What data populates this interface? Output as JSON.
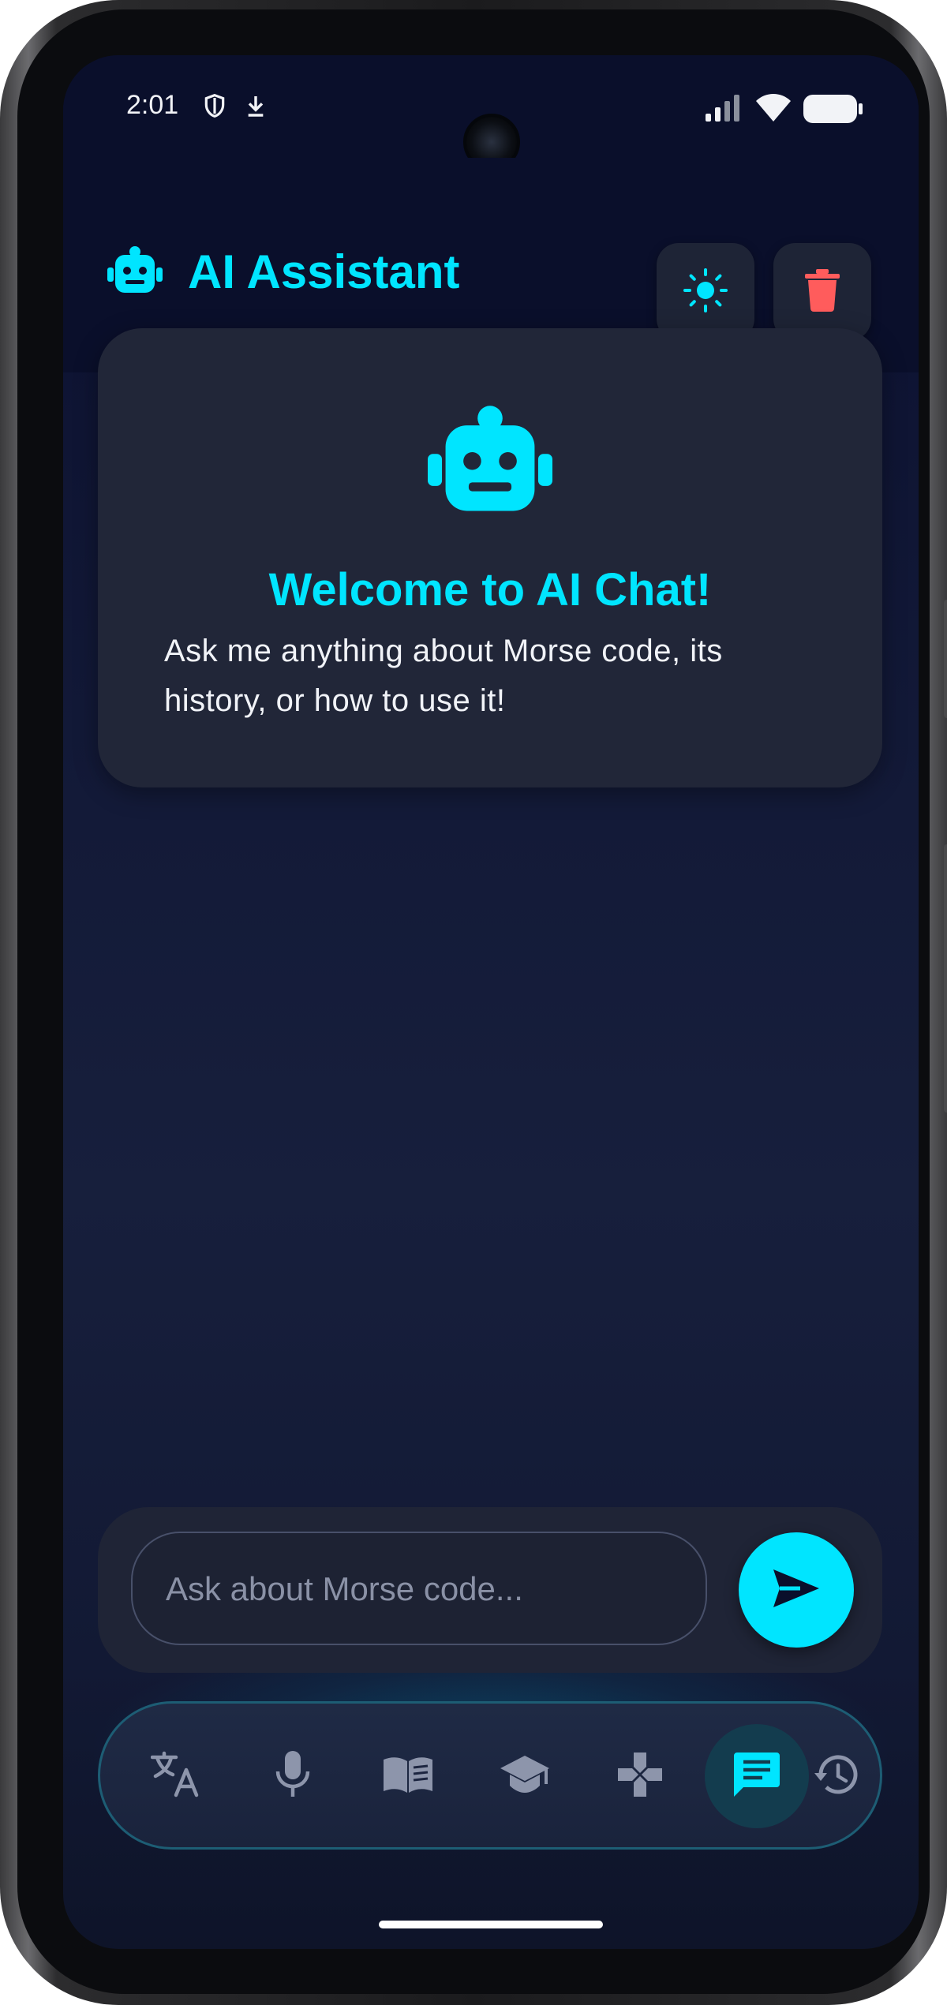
{
  "status_bar": {
    "time": "2:01",
    "icons": [
      "shield-icon",
      "download-icon",
      "signal-icon",
      "wifi-icon",
      "battery-icon"
    ]
  },
  "header": {
    "title": "AI Assistant",
    "logo_icon": "robot-icon",
    "actions": [
      {
        "name": "theme-toggle",
        "icon": "sun-icon"
      },
      {
        "name": "clear-chat",
        "icon": "trash-icon"
      }
    ]
  },
  "welcome": {
    "icon": "robot-icon",
    "title": "Welcome to AI Chat!",
    "text": "Ask me anything about Morse code, its history, or how to use it!"
  },
  "input": {
    "value": "",
    "placeholder": "Ask about Morse code...",
    "send_icon": "send-icon"
  },
  "bottom_nav": {
    "items": [
      {
        "name": "translate",
        "icon": "translate-icon",
        "active": false
      },
      {
        "name": "voice",
        "icon": "microphone-icon",
        "active": false
      },
      {
        "name": "reference",
        "icon": "book-icon",
        "active": false
      },
      {
        "name": "learn",
        "icon": "graduation-cap-icon",
        "active": false
      },
      {
        "name": "games",
        "icon": "gamepad-icon",
        "active": false
      },
      {
        "name": "chat",
        "icon": "chat-icon",
        "active": true
      },
      {
        "name": "history",
        "icon": "history-icon",
        "active": false
      }
    ]
  },
  "colors": {
    "accent": "#00e5ff",
    "danger": "#ff5c5c",
    "background": "#131a38",
    "card": "#212638",
    "nav_inactive": "#8d95ab"
  }
}
